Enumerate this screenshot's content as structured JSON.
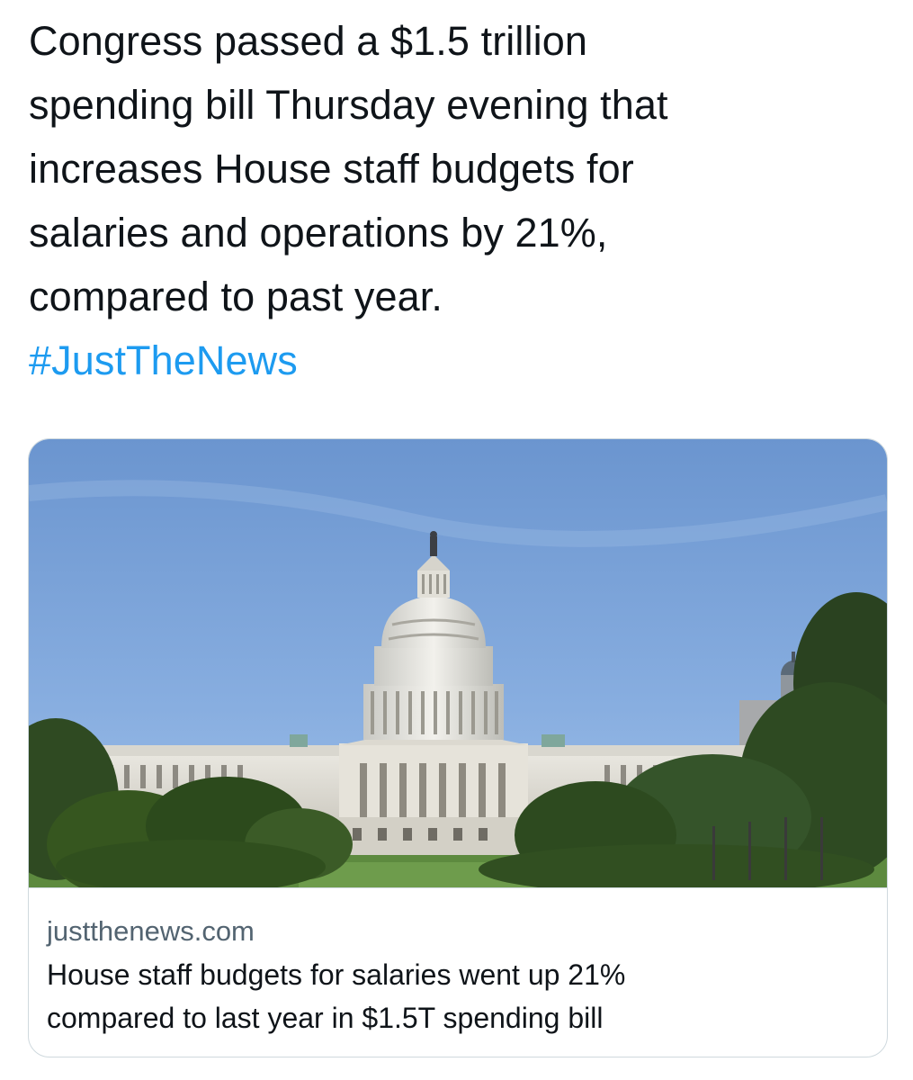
{
  "tweet": {
    "text_lines": [
      "Congress passed a $1.5 trillion",
      "spending bill Thursday evening that",
      "increases House staff budgets for",
      "salaries and operations by 21%,",
      "compared to past year."
    ],
    "hashtag": "#JustTheNews"
  },
  "link_card": {
    "image_subject": "us-capitol-building-photo",
    "domain": "justthenews.com",
    "title_lines": [
      "House staff budgets for salaries went up 21%",
      "compared to last year in $1.5T spending bill"
    ]
  },
  "colors": {
    "text": "#0f1419",
    "link": "#1d9bf0",
    "muted": "#536471",
    "border": "#cfd9de"
  }
}
